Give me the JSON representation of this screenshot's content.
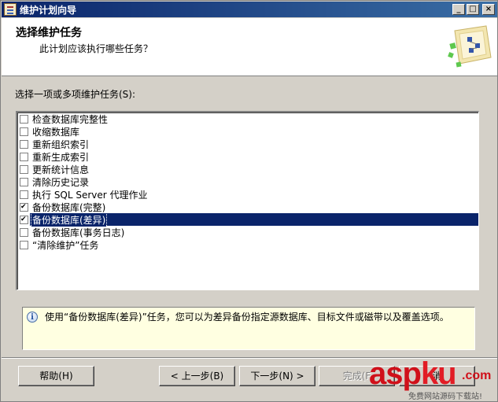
{
  "window": {
    "title": "维护计划向导",
    "controls": [
      "_",
      "□",
      "×"
    ]
  },
  "header": {
    "title": "选择维护任务",
    "subtitle": "此计划应该执行哪些任务？",
    "graphic_icon": "wizard-graphic-icon"
  },
  "task_list": {
    "label": "选择一项或多项维护任务(S):",
    "items": [
      {
        "label": "检查数据库完整性",
        "checked": false,
        "selected": false
      },
      {
        "label": "收缩数据库",
        "checked": false,
        "selected": false
      },
      {
        "label": "重新组织索引",
        "checked": false,
        "selected": false
      },
      {
        "label": "重新生成索引",
        "checked": false,
        "selected": false
      },
      {
        "label": "更新统计信息",
        "checked": false,
        "selected": false
      },
      {
        "label": "清除历史记录",
        "checked": false,
        "selected": false
      },
      {
        "label": "执行 SQL Server 代理作业",
        "checked": false,
        "selected": false
      },
      {
        "label": "备份数据库(完整)",
        "checked": true,
        "selected": false
      },
      {
        "label": "备份数据库(差异)",
        "checked": true,
        "selected": true
      },
      {
        "label": "备份数据库(事务日志)",
        "checked": false,
        "selected": false
      },
      {
        "label": "“清除维护”任务",
        "checked": false,
        "selected": false
      }
    ]
  },
  "info": {
    "text": "使用“备份数据库(差异)”任务，您可以为差异备份指定源数据库、目标文件或磁带以及覆盖选项。"
  },
  "buttons": {
    "help": "帮助(H)",
    "back": "< 上一步(B)",
    "next": "下一步(N) >",
    "finish": "完成(F",
    "cancel": "消"
  },
  "watermark": {
    "main_a": "asp",
    "main_b": "ku",
    "tld": ".com",
    "sub": "免费网站源码下载站!"
  },
  "colors": {
    "title_bar": "#0a246a",
    "selection": "#0a246a",
    "info_background": "#ffffe1",
    "watermark": "#d0101a"
  }
}
